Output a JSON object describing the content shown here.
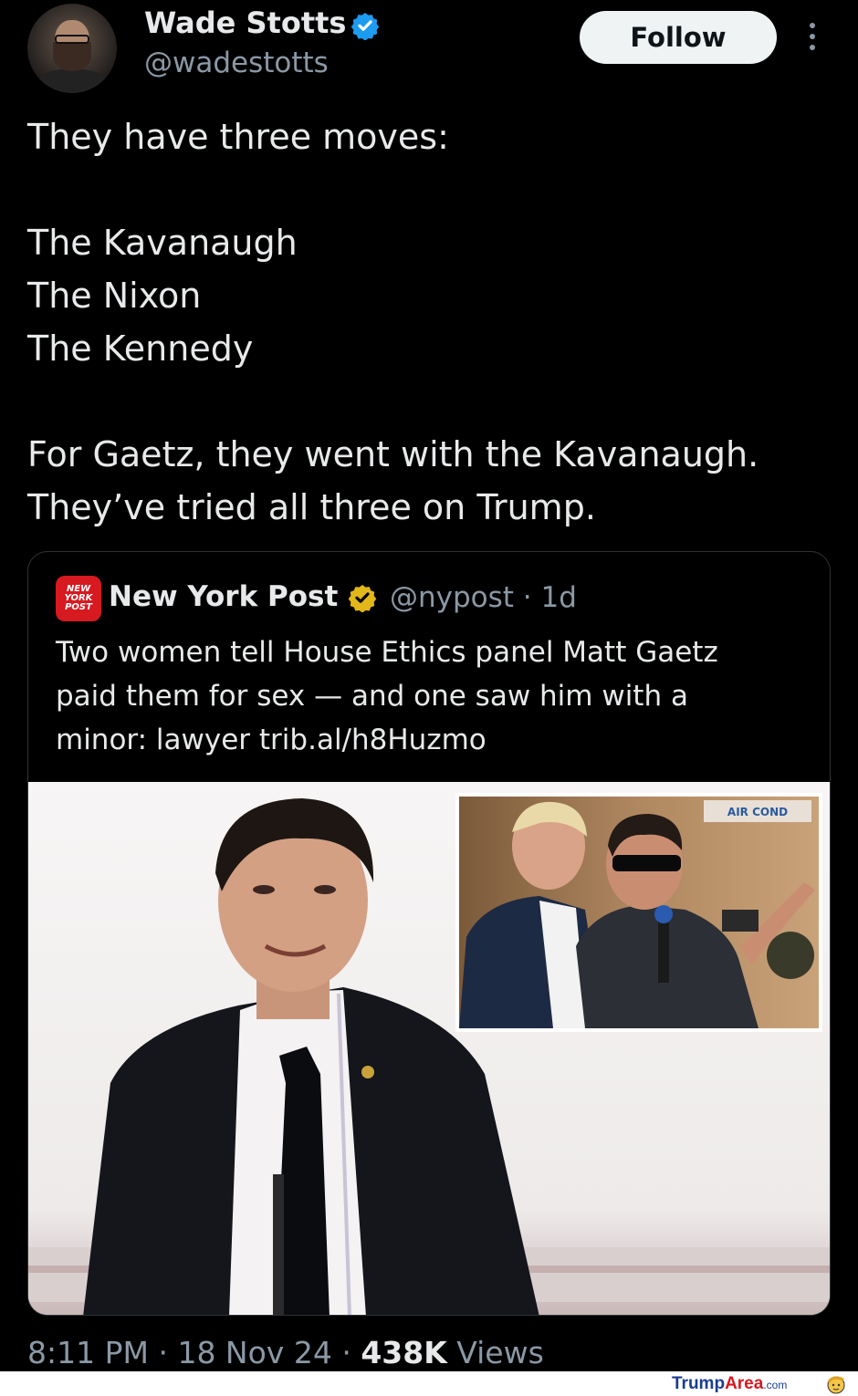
{
  "author": {
    "name": "Wade Stotts",
    "handle": "@wadestotts",
    "follow_label": "Follow"
  },
  "tweet": {
    "lines": [
      "They have three moves:",
      "The Kavanaugh",
      "The Nixon",
      "The Kennedy",
      "For Gaetz, they went with the Kavanaugh.",
      "They’ve tried all three on Trump."
    ]
  },
  "quoted": {
    "logo_text": "NEW YORK POST",
    "name": "New York Post",
    "handle": "@nypost",
    "time": "1d",
    "text_lines": [
      "Two women tell House Ethics panel Matt Gaetz",
      "paid them for sex — and one saw him with a",
      "minor: lawyer trib.al/h8Huzmo"
    ],
    "inset_sign_text": "AIR COND"
  },
  "meta": {
    "time": "8:11 PM",
    "date": "18 Nov 24",
    "views_count": "438K",
    "views_label": "Views"
  },
  "watermark": {
    "part1": "Trump",
    "part2": "Area",
    "part3": ".com"
  },
  "colors": {
    "background": "#000000",
    "text": "#e7e9ea",
    "muted": "#8b98a5",
    "verified_blue": "#1d9bf0",
    "verified_gold": "#e2b719",
    "nypost_red": "#d71920"
  }
}
